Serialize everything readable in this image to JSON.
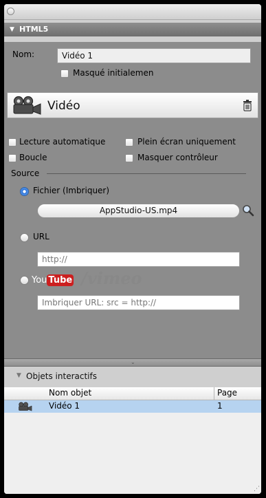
{
  "window": {
    "section_title": "HTML5"
  },
  "inspector": {
    "name_label": "Nom:",
    "name_value": "Vidéo 1",
    "hidden_label": "Masqué initialemen",
    "video_title": "Vidéo",
    "autoplay_label": "Lecture automatique",
    "fullscreen_label": "Plein écran uniquement",
    "loop_label": "Boucle",
    "hide_controller_label": "Masquer contrôleur",
    "source_label": "Source",
    "file_option_label": "Fichier (Imbriquer)",
    "file_value": "AppStudio-US.mp4",
    "url_option_label": "URL",
    "url_placeholder": "http://",
    "youtube_you": "You",
    "youtube_tube": "Tube",
    "vimeo_slash": "/",
    "vimeo_label": "vimeo",
    "embed_placeholder": "Imbriquer URL: src = http://"
  },
  "objects": {
    "title": "Objets interactifs",
    "col_name": "Nom objet",
    "col_page": "Page",
    "rows": [
      {
        "name": "Vidéo 1",
        "page": "1"
      }
    ]
  },
  "colors": {
    "selection": "#b6d3f0",
    "radio_accent": "#2a6fd6",
    "youtube_red": "#cc1f1f"
  }
}
